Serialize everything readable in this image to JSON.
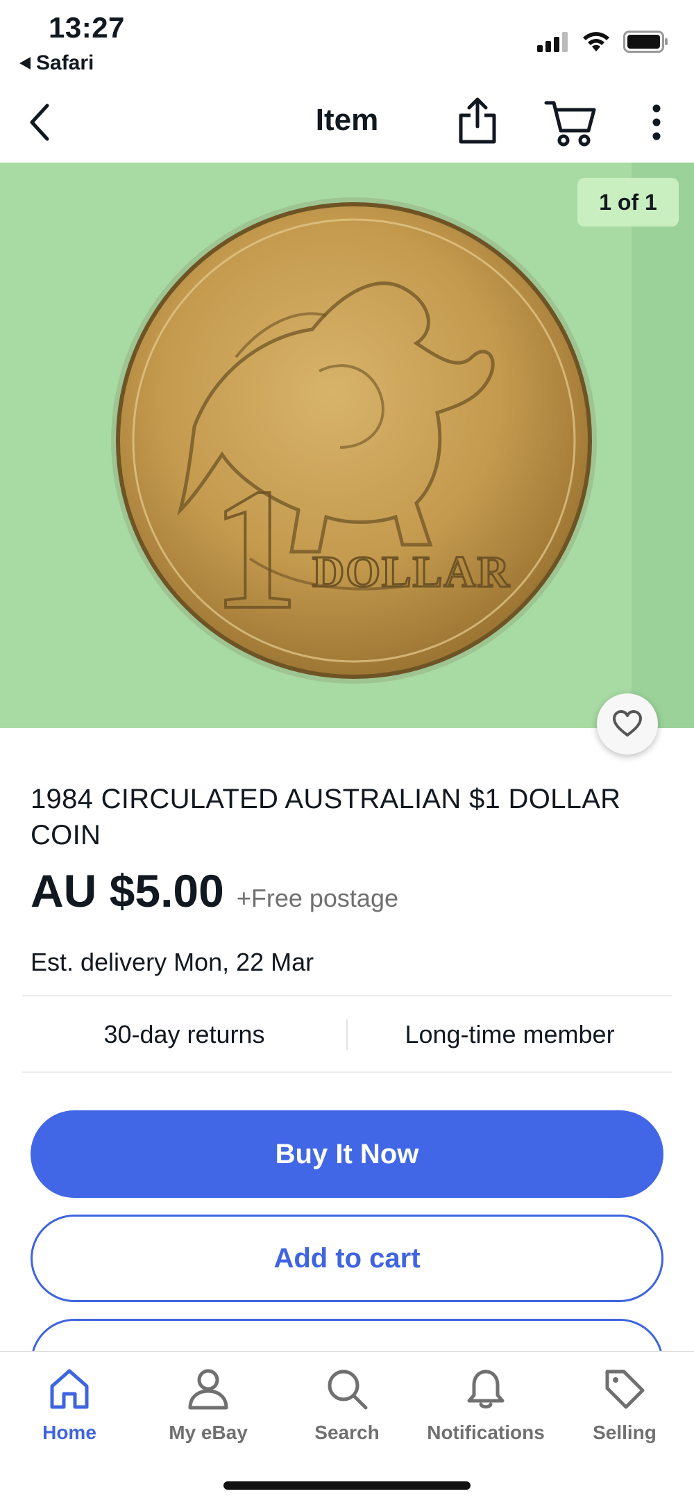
{
  "status_bar": {
    "time": "13:27",
    "back_app": "Safari",
    "icons": [
      "signal-icon",
      "wifi-icon",
      "battery-icon"
    ]
  },
  "nav": {
    "title": "Item",
    "icons": [
      "chevron-left-icon",
      "share-icon",
      "cart-icon",
      "more-vertical-icon"
    ]
  },
  "gallery": {
    "counter": "1 of 1",
    "background_color": "#a8dba3",
    "image_description_icon": "coin-image"
  },
  "item": {
    "title": "1984 CIRCULATED AUSTRALIAN $1 DOLLAR COIN",
    "price": "AU $5.00",
    "postage": "+Free postage",
    "delivery": "Est. delivery Mon, 22 Mar",
    "features": [
      "30-day returns",
      "Long-time member"
    ]
  },
  "actions": {
    "buy_now": "Buy It Now",
    "add_to_cart": "Add to cart"
  },
  "tabs": [
    {
      "label": "Home",
      "icon": "home-icon",
      "active": true
    },
    {
      "label": "My eBay",
      "icon": "person-icon",
      "active": false
    },
    {
      "label": "Search",
      "icon": "search-icon",
      "active": false
    },
    {
      "label": "Notifications",
      "icon": "bell-icon",
      "active": false
    },
    {
      "label": "Selling",
      "icon": "tag-icon",
      "active": false
    }
  ],
  "colors": {
    "accent": "#3f64e0",
    "primary_button": "#4267e6",
    "text": "#111820",
    "muted": "#707070"
  }
}
